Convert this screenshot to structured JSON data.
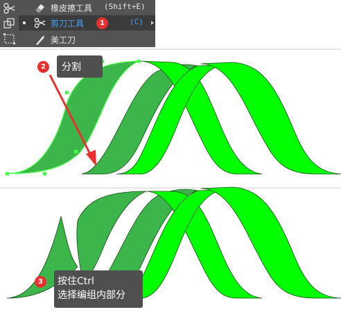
{
  "tool_menu": {
    "items": [
      {
        "label": "橡皮擦工具",
        "shortcut": "(Shift+E)",
        "icon": "eraser-icon",
        "active": false
      },
      {
        "label": "剪刀工具",
        "shortcut": "(C)",
        "icon": "scissors-icon",
        "active": true,
        "badge": "1"
      },
      {
        "label": "美工刀",
        "shortcut": "",
        "icon": "knife-icon",
        "active": false
      }
    ],
    "active_color": "#4aa3ff"
  },
  "callouts": {
    "split": {
      "badge": "2",
      "text": "分割"
    },
    "ctrl": {
      "badge": "3",
      "line1": "按住Ctrl",
      "line2": "选择编组内部分"
    }
  },
  "colors": {
    "bright_green": "#00ff00",
    "dark_green": "#3cb54a",
    "selection": "#4dff4d",
    "arrow_red": "#e8312f",
    "badge_red": "#e8312f"
  }
}
